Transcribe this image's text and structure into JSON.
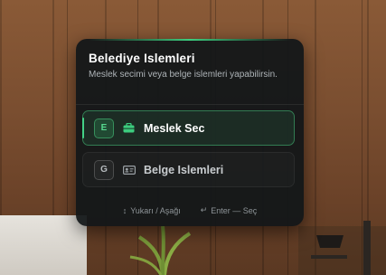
{
  "menu": {
    "title": "Belediye Islemleri",
    "subtitle": "Meslek secimi veya belge islemleri yapabilirsin.",
    "options": [
      {
        "key": "E",
        "label": "Meslek Sec",
        "icon": "briefcase-icon",
        "selected": true
      },
      {
        "key": "G",
        "label": "Belge Islemleri",
        "icon": "id-card-icon",
        "selected": false
      }
    ],
    "hints": [
      {
        "icon": "up-down-arrows-icon",
        "text": "Yukarı / Aşağı"
      },
      {
        "icon": "enter-arrow-icon",
        "text": "Enter — Seç"
      }
    ]
  },
  "colors": {
    "accent": "#3ccc7e",
    "panel_bg": "#121618",
    "text_primary": "#ffffff",
    "text_muted": "#aeb4b8"
  }
}
